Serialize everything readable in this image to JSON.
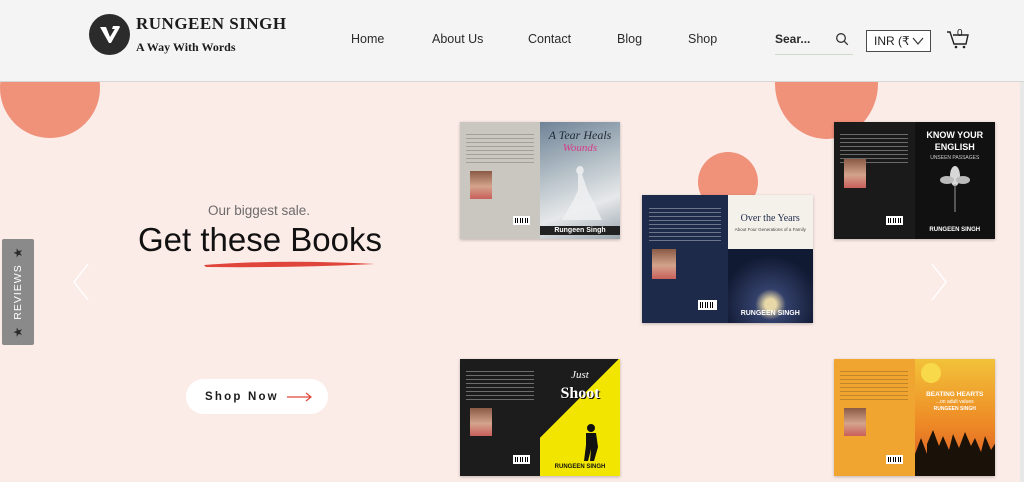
{
  "brand": {
    "name": "RUNGEEN SINGH",
    "tagline": "A Way With Words"
  },
  "nav": {
    "items": [
      "Home",
      "About Us",
      "Contact",
      "Blog",
      "Shop"
    ]
  },
  "search": {
    "label": "Sear..."
  },
  "currency": {
    "value": "INR (₹"
  },
  "cart": {
    "count": "0"
  },
  "hero": {
    "subtitle": "Our biggest sale.",
    "headline_prefix": "Get ",
    "headline_underlined": "these",
    "headline_suffix": " Books",
    "cta": "Shop Now",
    "accent": "#f0917a",
    "background": "#fcece8"
  },
  "reviews_tab": {
    "label": "REVIEWS"
  },
  "books": [
    {
      "title_line1": "A Tear Heals",
      "title_line2": "Wounds",
      "author": "Rungeen Singh"
    },
    {
      "title": "Over the Years",
      "subtitle": "About Four Generations of a Family",
      "author": "RUNGEEN SINGH"
    },
    {
      "title_line1": "KNOW YOUR",
      "title_line2": "ENGLISH",
      "subtitle": "UNSEEN PASSAGES",
      "author": "RUNGEEN SINGH"
    },
    {
      "title_line1": "Just",
      "title_line2": "Shoot",
      "author": "RUNGEEN SINGH"
    },
    {
      "title": "BEATING HEARTS",
      "subtitle": "...on adult values",
      "author": "RUNGEEN SINGH"
    }
  ]
}
